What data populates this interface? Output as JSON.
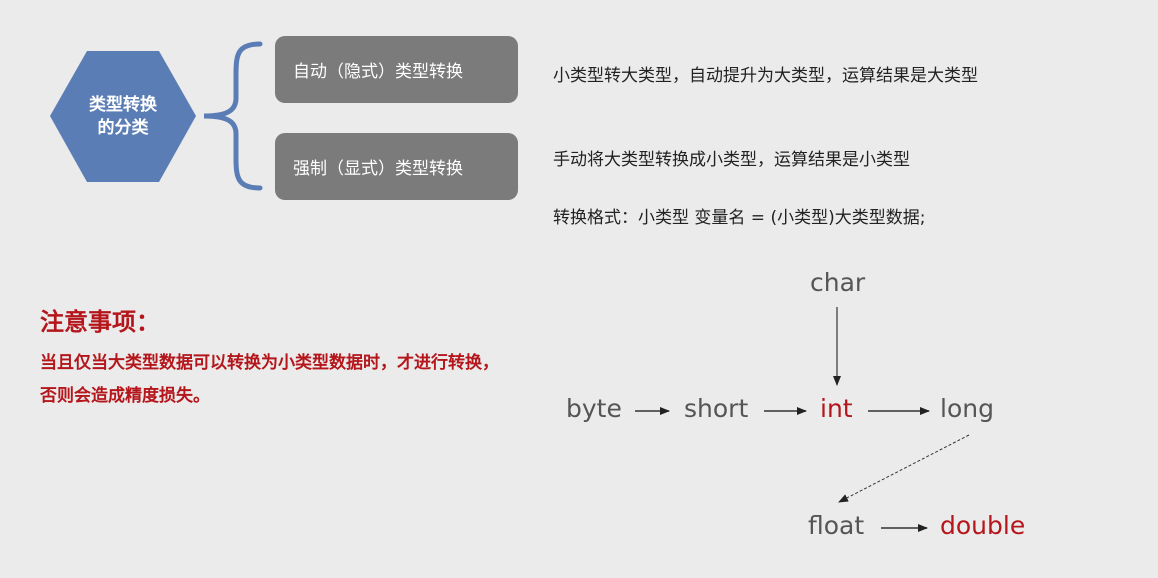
{
  "hexagon": {
    "line1": "类型转换",
    "line2": "的分类"
  },
  "categories": [
    {
      "label": "自动（隐式）类型转换",
      "description": "小类型转大类型，自动提升为大类型，运算结果是大类型"
    },
    {
      "label": "强制（显式）类型转换",
      "description": "手动将大类型转换成小类型，运算结果是小类型",
      "format": "转换格式：小类型 变量名 = (小类型)大类型数据;"
    }
  ],
  "note": {
    "title": "注意事项：",
    "body": "当且仅当大类型数据可以转换为小类型数据时，才进行转换，否则会造成精度损失。"
  },
  "types": {
    "char": "char",
    "byte": "byte",
    "short": "short",
    "int": "int",
    "long": "long",
    "float": "float",
    "double": "double"
  },
  "colors": {
    "background": "#ebebeb",
    "hexagon": "#5b7db5",
    "brace": "#5b7db5",
    "pill": "#7b7b7b",
    "highlight": "#b4161b",
    "type_text": "#555555"
  }
}
